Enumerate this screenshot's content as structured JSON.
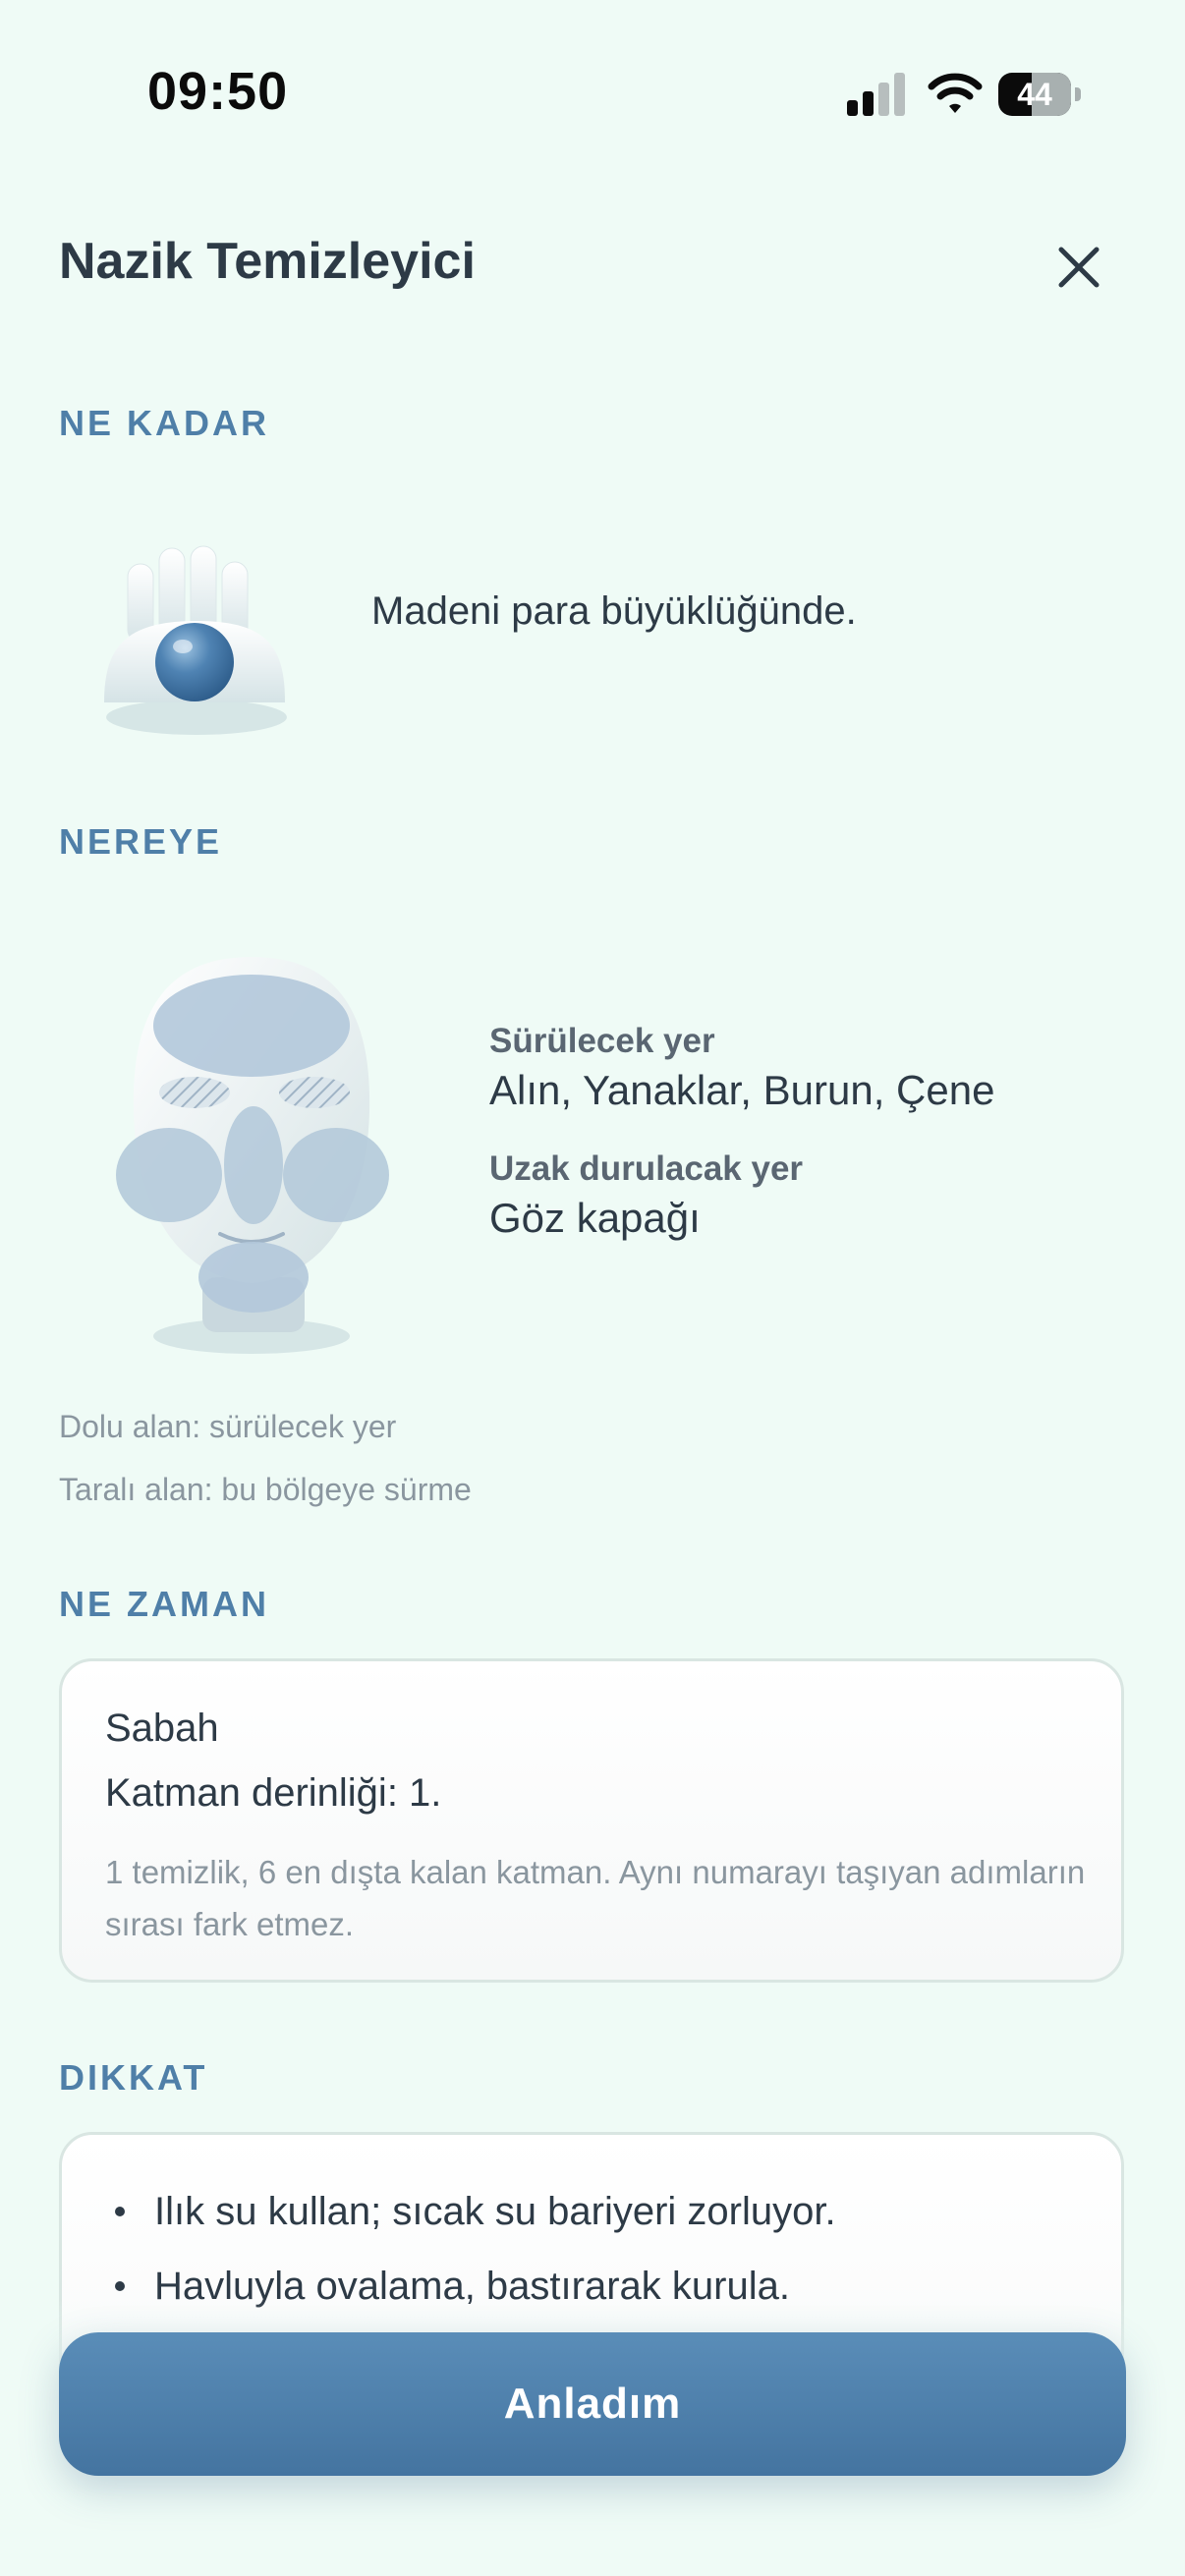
{
  "status_bar": {
    "time": "09:50",
    "battery": "44"
  },
  "title": "Nazik Temizleyici",
  "sections": {
    "amount": {
      "title": "NE KADAR",
      "text": "Madeni para büyüklüğünde."
    },
    "where": {
      "title": "NEREYE",
      "apply_label": "Sürülecek yer",
      "apply_value": "Alın, Yanaklar, Burun, Çene",
      "avoid_label": "Uzak durulacak yer",
      "avoid_value": "Göz kapağı",
      "legend_filled": "Dolu alan: sürülecek yer",
      "legend_hatched": "Taralı alan: bu bölgeye sürme"
    },
    "when": {
      "title": "NE ZAMAN",
      "time": "Sabah",
      "layer": "Katman derinliği: 1.",
      "note": "1 temizlik, 6 en dışta kalan katman. Aynı numarayı taşıyan adımların sırası fark etmez."
    },
    "caution": {
      "title": "DIKKAT",
      "items": [
        "Ilık su kullan; sıcak su bariyeri zorluyor.",
        "Havluyla ovalama, bastırarak kurula."
      ]
    }
  },
  "cta_label": "Anladım",
  "colors": {
    "accent": "#4F7FA8",
    "background": "#EFFBF6",
    "button": "#4F80AC"
  }
}
